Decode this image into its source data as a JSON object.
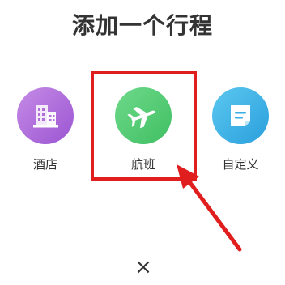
{
  "title": "添加一个行程",
  "options": [
    {
      "label": "酒店",
      "icon": "hotel-building-icon",
      "color": "#a865dc"
    },
    {
      "label": "航班",
      "icon": "airplane-icon",
      "color": "#4cc86f"
    },
    {
      "label": "自定义",
      "icon": "note-icon",
      "color": "#3aaee4"
    }
  ],
  "highlight_color": "#e01e1e",
  "close_label": "×"
}
